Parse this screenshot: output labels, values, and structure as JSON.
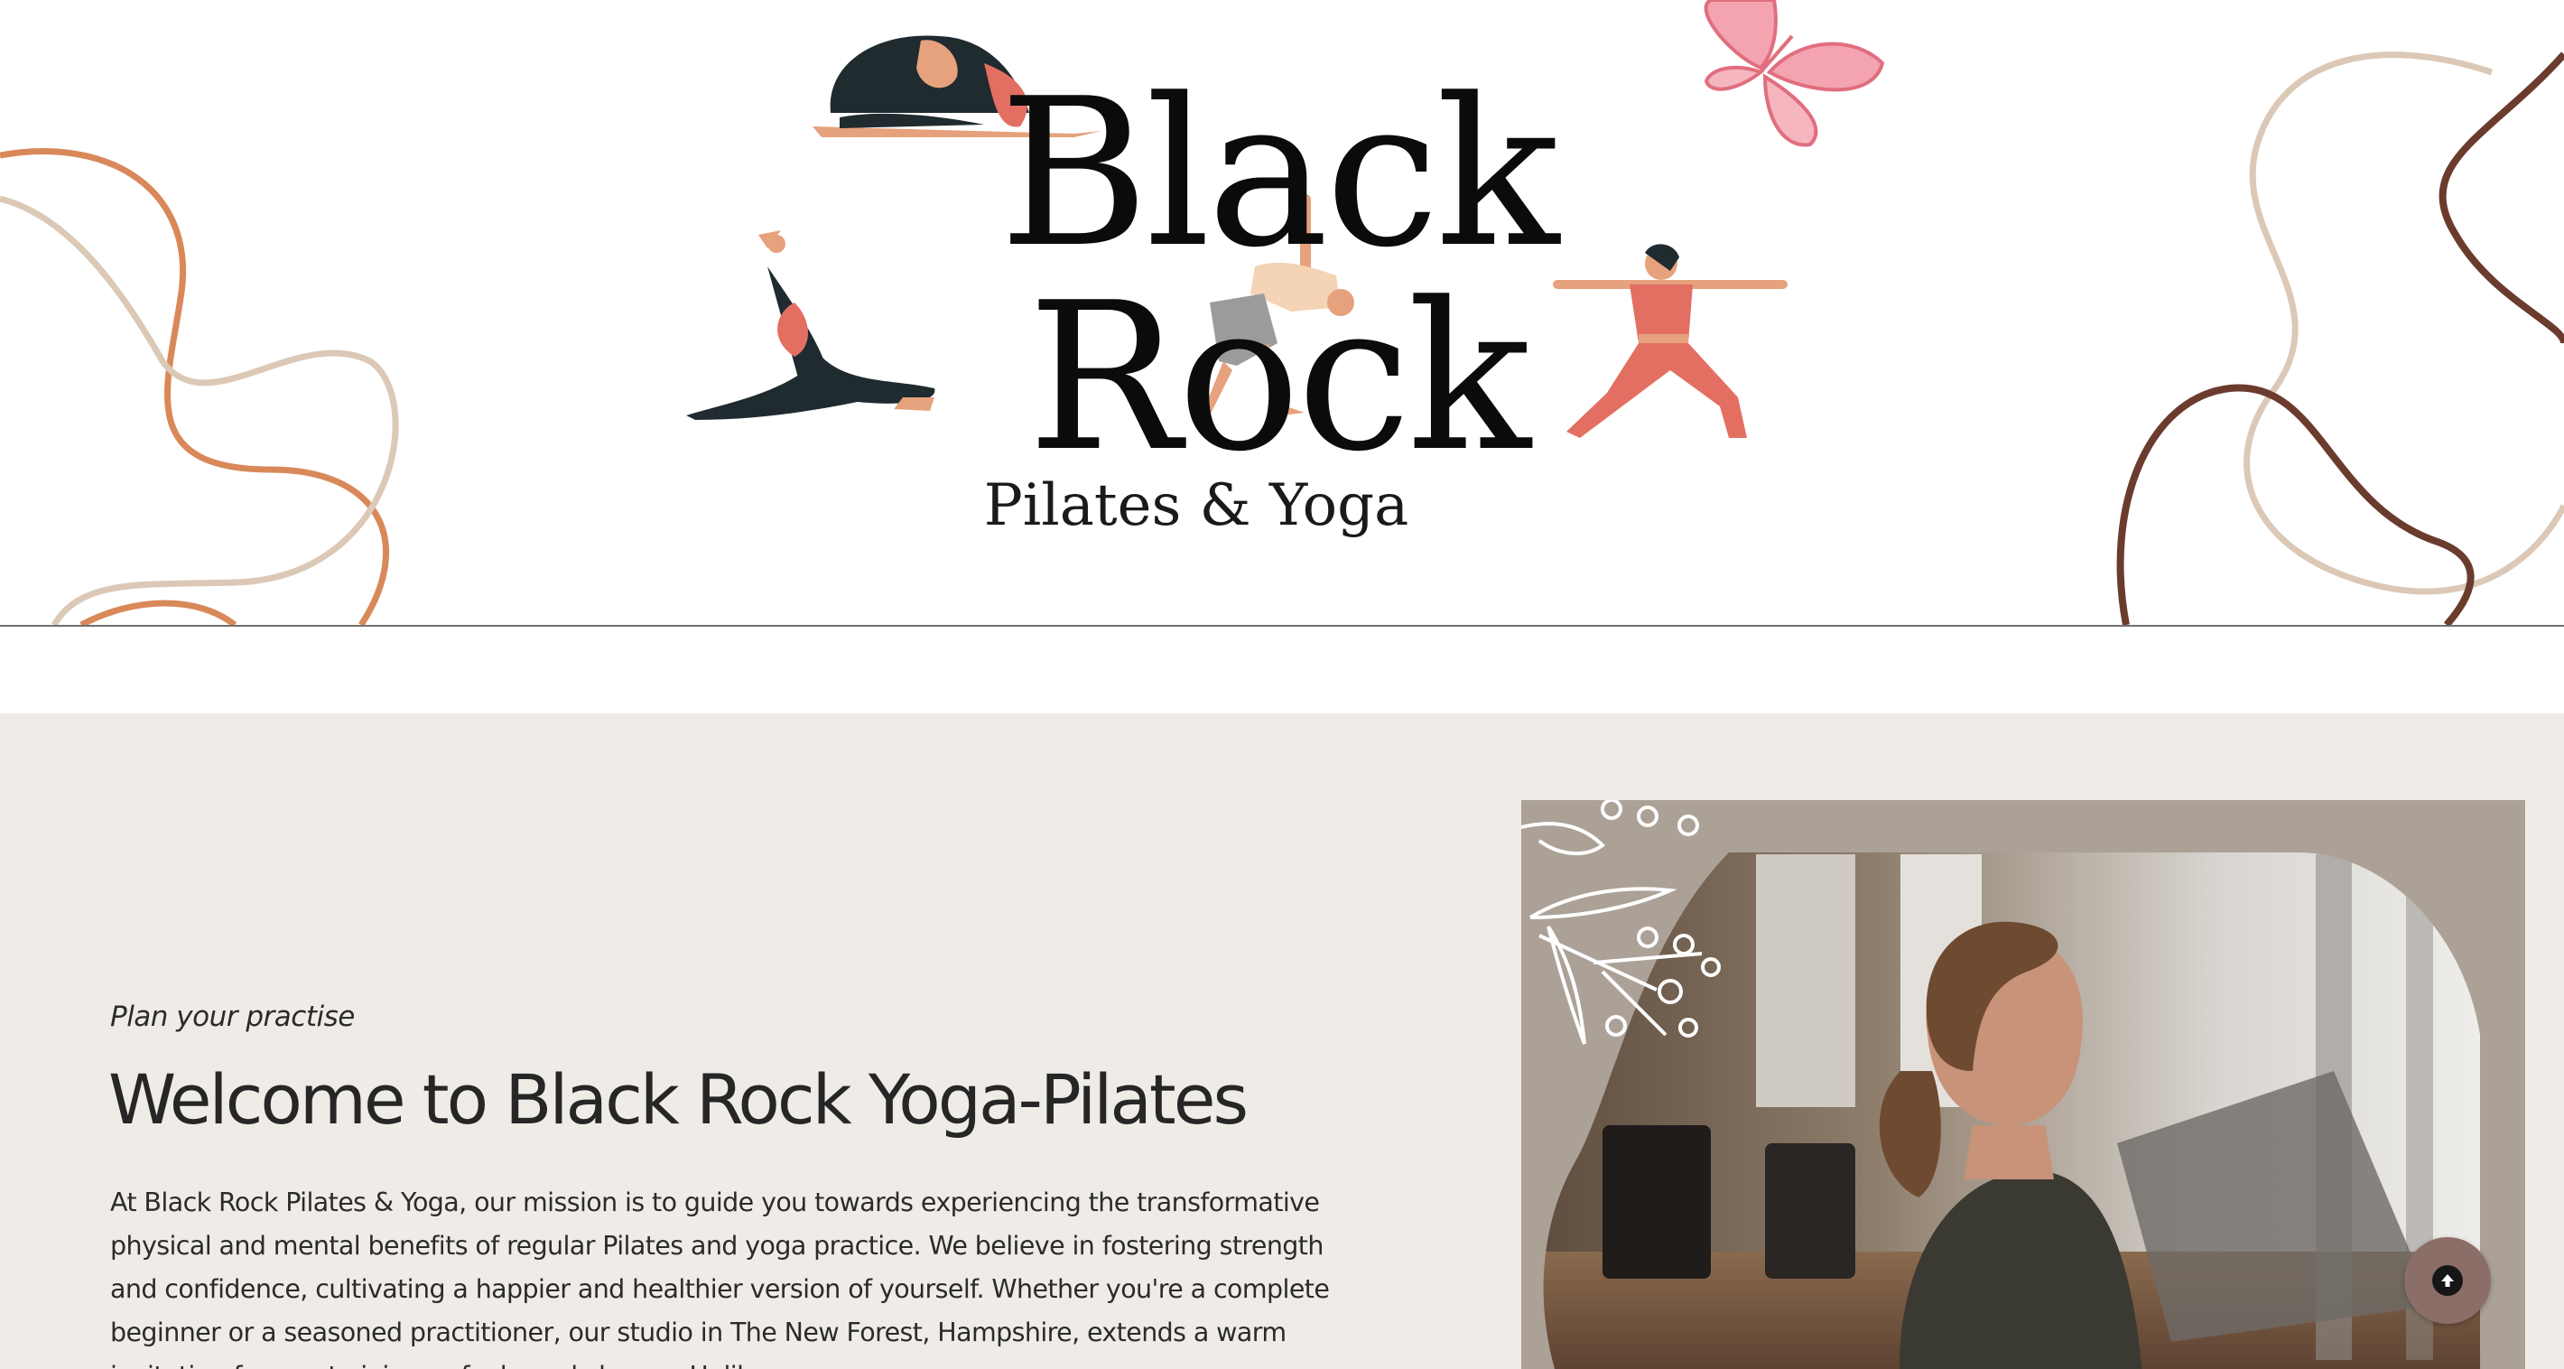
{
  "header": {
    "logo_title": "Black Rock",
    "logo_subtitle": "Pilates & Yoga"
  },
  "about": {
    "eyebrow": "Plan your practise",
    "title": "Welcome to Black Rock Yoga-Pilates",
    "body": "At Black Rock Pilates & Yoga, our mission is to guide you towards experiencing the transformative physical and mental benefits of regular Pilates and yoga practice. We believe in fostering strength and confidence, cultivating a happier and healthier version of yourself. Whether you're a complete beginner or a seasoned practitioner, our studio in The New Forest, Hampshire, extends a warm invitation for you to join our feel-good classes. Unlike"
  },
  "colors": {
    "section_bg": "#efece8",
    "swirl_orange": "#d9885a",
    "swirl_beige": "#dcc8b6",
    "swirl_brown": "#6b3b2d",
    "photo_frame": "#aba197",
    "scroll_button": "#8b6e67"
  },
  "icons": {
    "scroll_top": "arrow-up-icon",
    "butterfly": "butterfly-illustration"
  }
}
